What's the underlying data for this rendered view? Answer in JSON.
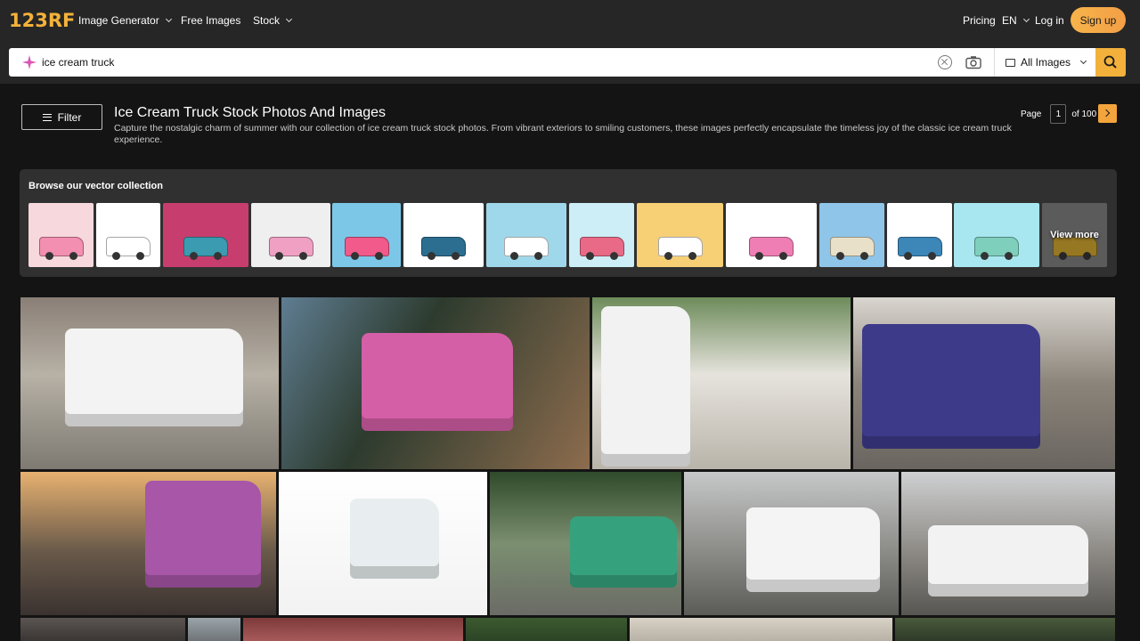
{
  "header": {
    "logo": "123RF",
    "nav": [
      "Image Generator",
      "Free Images",
      "Stock"
    ],
    "pricing": "Pricing",
    "lang": "EN",
    "login": "Log in",
    "signup": "Sign up"
  },
  "search": {
    "query": "ice cream truck",
    "scope": "All Images"
  },
  "results": {
    "filter_label": "Filter",
    "title": "Ice Cream Truck Stock Photos And Images",
    "description": "Capture the nostalgic charm of summer with our collection of ice cream truck stock photos. From vibrant exteriors to smiling customers, these images perfectly encapsulate the timeless joy of the classic ice cream truck experience.",
    "page_label": "Page",
    "page_current": "1",
    "page_total": "of 100"
  },
  "vectors": {
    "heading": "Browse our vector collection",
    "view_more": "View more",
    "colors": [
      "#f7d8dc",
      "#ffffff",
      "#c73e6e",
      "#efefef",
      "#7cc7e8",
      "#ffffff",
      "#9fd8ea",
      "#cdeef6",
      "#f7cf75",
      "#ffffff",
      "#8fc5e8",
      "#ffffff",
      "#a8e7ef",
      "#7a7a7a"
    ]
  },
  "photos": [
    {
      "name": "photo-white-truck-street"
    },
    {
      "name": "photo-colorful-truck-motion"
    },
    {
      "name": "photo-customers-at-truck"
    },
    {
      "name": "photo-blurred-truck-park"
    },
    {
      "name": "photo-purple-truck-sunset"
    },
    {
      "name": "photo-3d-truck-figures"
    },
    {
      "name": "photo-green-truck-city"
    },
    {
      "name": "photo-white-truck-nyc"
    },
    {
      "name": "photo-truck-i-love-ny"
    }
  ]
}
